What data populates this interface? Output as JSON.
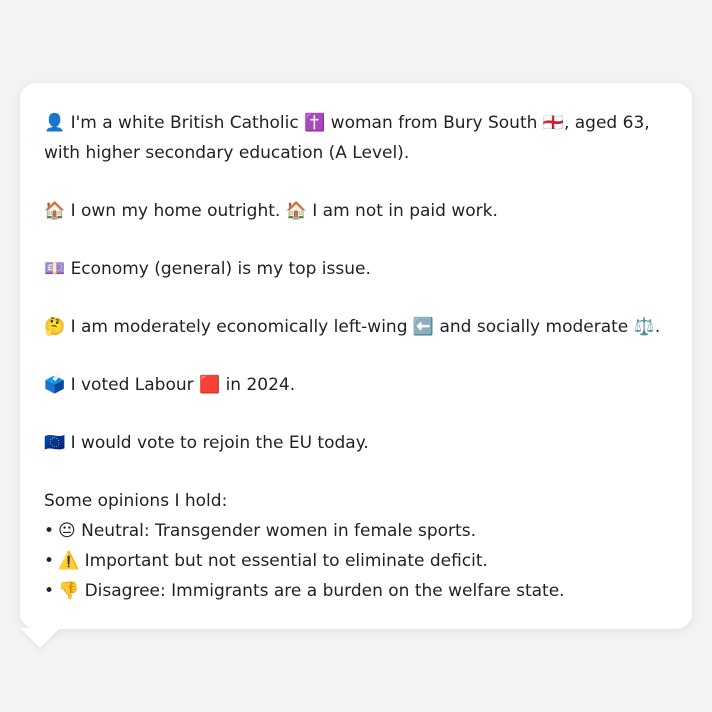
{
  "profile": {
    "identity": "👤 I'm a white British Catholic ✝️ woman from Bury South 🏴󠁧󠁢󠁥󠁮󠁧󠁿, aged 63, with higher secondary education (A Level).",
    "home": "🏠 I own my home outright. 🏠 I am not in paid work.",
    "issue": "💷 Economy (general) is my top issue.",
    "politics": "🤔 I am moderately economically left-wing ⬅️ and socially moderate ⚖️.",
    "vote": "🗳️ I voted Labour 🟥 in 2024.",
    "eu": "🇪🇺 I would vote to rejoin the EU today."
  },
  "opinions": {
    "title": "Some opinions I hold:",
    "bullet": "•",
    "items": [
      "😐 Neutral: Transgender women in female sports.",
      "⚠️ Important but not essential to eliminate deficit.",
      "👎 Disagree: Immigrants are a burden on the welfare state."
    ]
  }
}
